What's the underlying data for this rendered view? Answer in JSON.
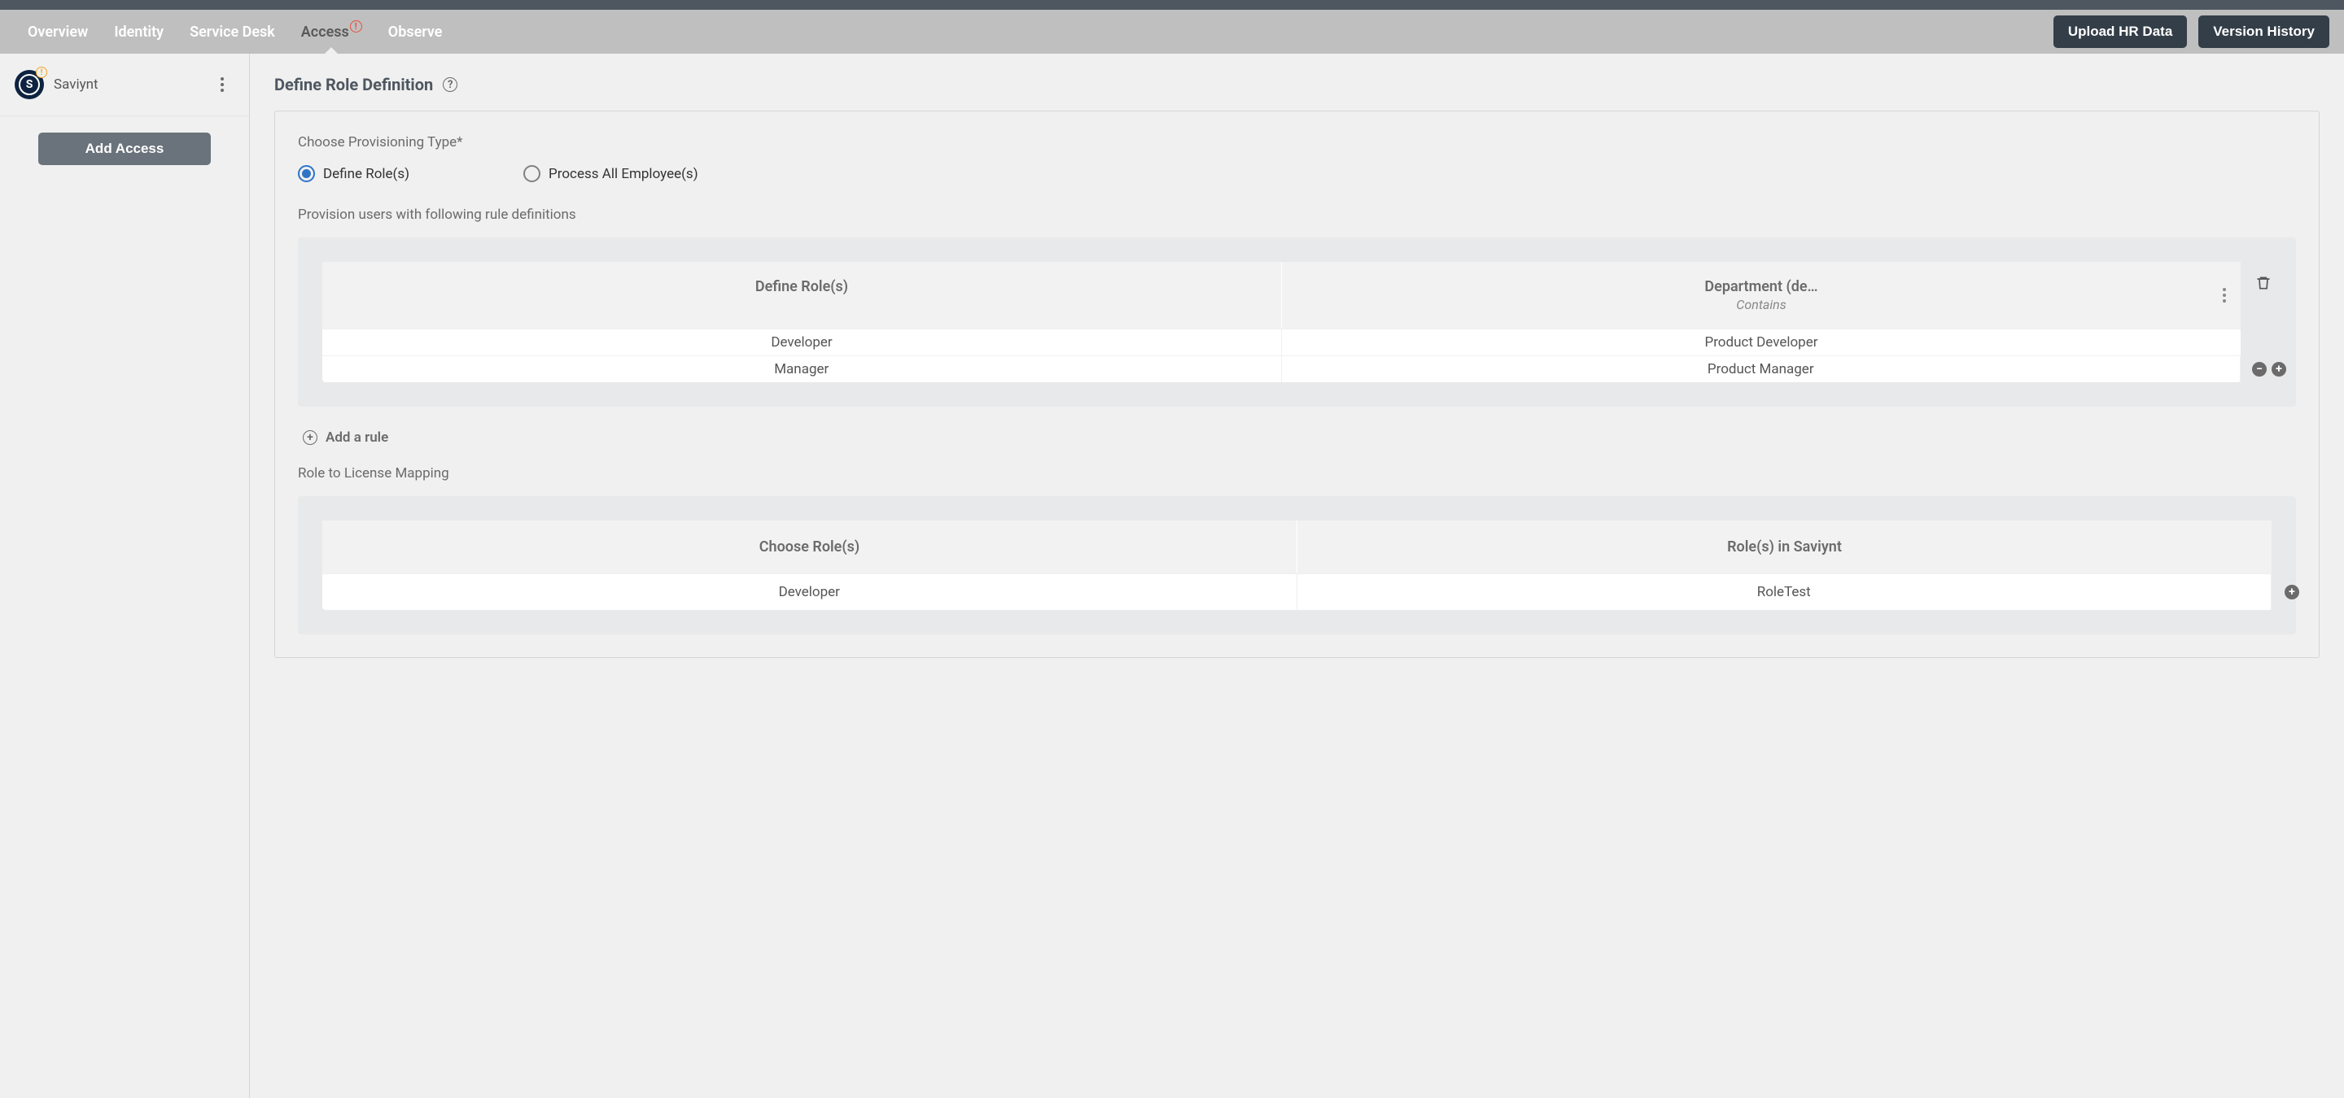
{
  "nav": {
    "tabs": [
      "Overview",
      "Identity",
      "Service Desk",
      "Access",
      "Observe"
    ],
    "active_index": 3,
    "upload_label": "Upload HR Data",
    "version_label": "Version History"
  },
  "sidebar": {
    "app_letter": "S",
    "app_name": "Saviynt",
    "add_access_label": "Add Access"
  },
  "page": {
    "title": "Define Role Definition",
    "provisioning_label": "Choose Provisioning Type*",
    "radio_define": "Define Role(s)",
    "radio_process": "Process All Employee(s)",
    "provision_sub": "Provision users with following rule definitions",
    "add_rule_label": "Add a rule",
    "mapping_label": "Role to License Mapping"
  },
  "rules_table": {
    "col1": "Define Role(s)",
    "col2_title": "Department (de…",
    "col2_sub": "Contains",
    "rows": [
      {
        "role": "Developer",
        "dept": "Product Developer"
      },
      {
        "role": "Manager",
        "dept": "Product Manager"
      }
    ]
  },
  "mapping_table": {
    "col1": "Choose Role(s)",
    "col2": "Role(s) in Saviynt",
    "rows": [
      {
        "role": "Developer",
        "saviynt": "RoleTest"
      }
    ]
  }
}
